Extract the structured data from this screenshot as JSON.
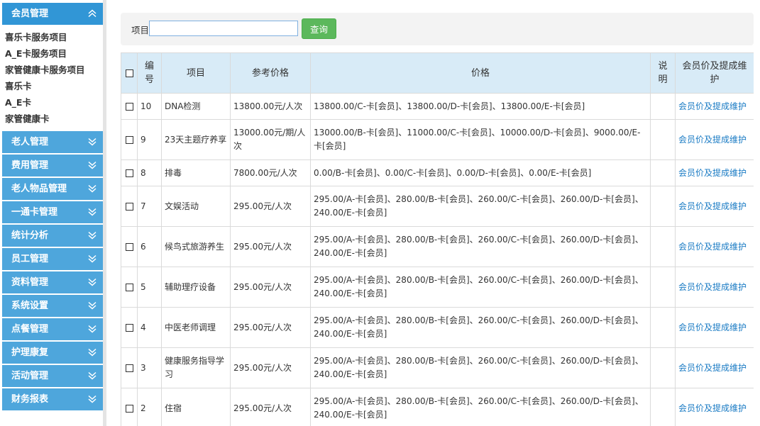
{
  "sidebar": {
    "open_section": {
      "label": "会员管理",
      "items": [
        "喜乐卡服务项目",
        "A_E卡服务项目",
        "家管健康卡服务项目",
        "喜乐卡",
        "A_E卡",
        "家管健康卡"
      ]
    },
    "sections": [
      "老人管理",
      "费用管理",
      "老人物品管理",
      "一通卡管理",
      "统计分析",
      "员工管理",
      "资料管理",
      "系统设置",
      "点餐管理",
      "护理康复",
      "活动管理",
      "财务报表"
    ]
  },
  "search": {
    "label": "项目",
    "value": "",
    "placeholder": "",
    "button": "查询"
  },
  "table": {
    "headers": {
      "id": "编号",
      "item": "项目",
      "ref_price": "参考价格",
      "price": "价格",
      "note": "说明",
      "action": "会员价及提成维护"
    },
    "rows": [
      {
        "id": "10",
        "item": "DNA检测",
        "ref_price": "13800.00元/人次",
        "price": "13800.00/C-卡[会员]、13800.00/D-卡[会员]、13800.00/E-卡[会员]",
        "note": "",
        "action": "会员价及提成维护"
      },
      {
        "id": "9",
        "item": "23天主题疗养享",
        "ref_price": "13000.00元/期/人次",
        "price": "13000.00/B-卡[会员]、11000.00/C-卡[会员]、10000.00/D-卡[会员]、9000.00/E-卡[会员]",
        "note": "",
        "action": "会员价及提成维护"
      },
      {
        "id": "8",
        "item": "排毒",
        "ref_price": "7800.00元/人次",
        "price": "0.00/B-卡[会员]、0.00/C-卡[会员]、0.00/D-卡[会员]、0.00/E-卡[会员]",
        "note": "",
        "action": "会员价及提成维护"
      },
      {
        "id": "7",
        "item": "文娱活动",
        "ref_price": "295.00元/人次",
        "price": "295.00/A-卡[会员]、280.00/B-卡[会员]、260.00/C-卡[会员]、260.00/D-卡[会员]、240.00/E-卡[会员]",
        "note": "",
        "action": "会员价及提成维护"
      },
      {
        "id": "6",
        "item": "候鸟式旅游养生",
        "ref_price": "295.00元/人次",
        "price": "295.00/A-卡[会员]、280.00/B-卡[会员]、260.00/C-卡[会员]、260.00/D-卡[会员]、240.00/E-卡[会员]",
        "note": "",
        "action": "会员价及提成维护"
      },
      {
        "id": "5",
        "item": "辅助理疗设备",
        "ref_price": "295.00元/人次",
        "price": "295.00/A-卡[会员]、280.00/B-卡[会员]、260.00/C-卡[会员]、260.00/D-卡[会员]、240.00/E-卡[会员]",
        "note": "",
        "action": "会员价及提成维护"
      },
      {
        "id": "4",
        "item": "中医老师调理",
        "ref_price": "295.00元/人次",
        "price": "295.00/A-卡[会员]、280.00/B-卡[会员]、260.00/C-卡[会员]、260.00/D-卡[会员]、240.00/E-卡[会员]",
        "note": "",
        "action": "会员价及提成维护"
      },
      {
        "id": "3",
        "item": "健康服务指导学习",
        "ref_price": "295.00元/人次",
        "price": "295.00/A-卡[会员]、280.00/B-卡[会员]、260.00/C-卡[会员]、260.00/D-卡[会员]、240.00/E-卡[会员]",
        "note": "",
        "action": "会员价及提成维护"
      },
      {
        "id": "2",
        "item": "住宿",
        "ref_price": "295.00元/人次",
        "price": "295.00/A-卡[会员]、280.00/B-卡[会员]、260.00/C-卡[会员]、260.00/D-卡[会员]、240.00/E-卡[会员]",
        "note": "",
        "action": "会员价及提成维护"
      }
    ]
  },
  "colors": {
    "sidebar_header": "#4ea6dc",
    "sidebar_header_open": "#3196d6",
    "table_header": "#d8ebf7",
    "search_button": "#5cb85c",
    "link": "#1a7bc4"
  }
}
